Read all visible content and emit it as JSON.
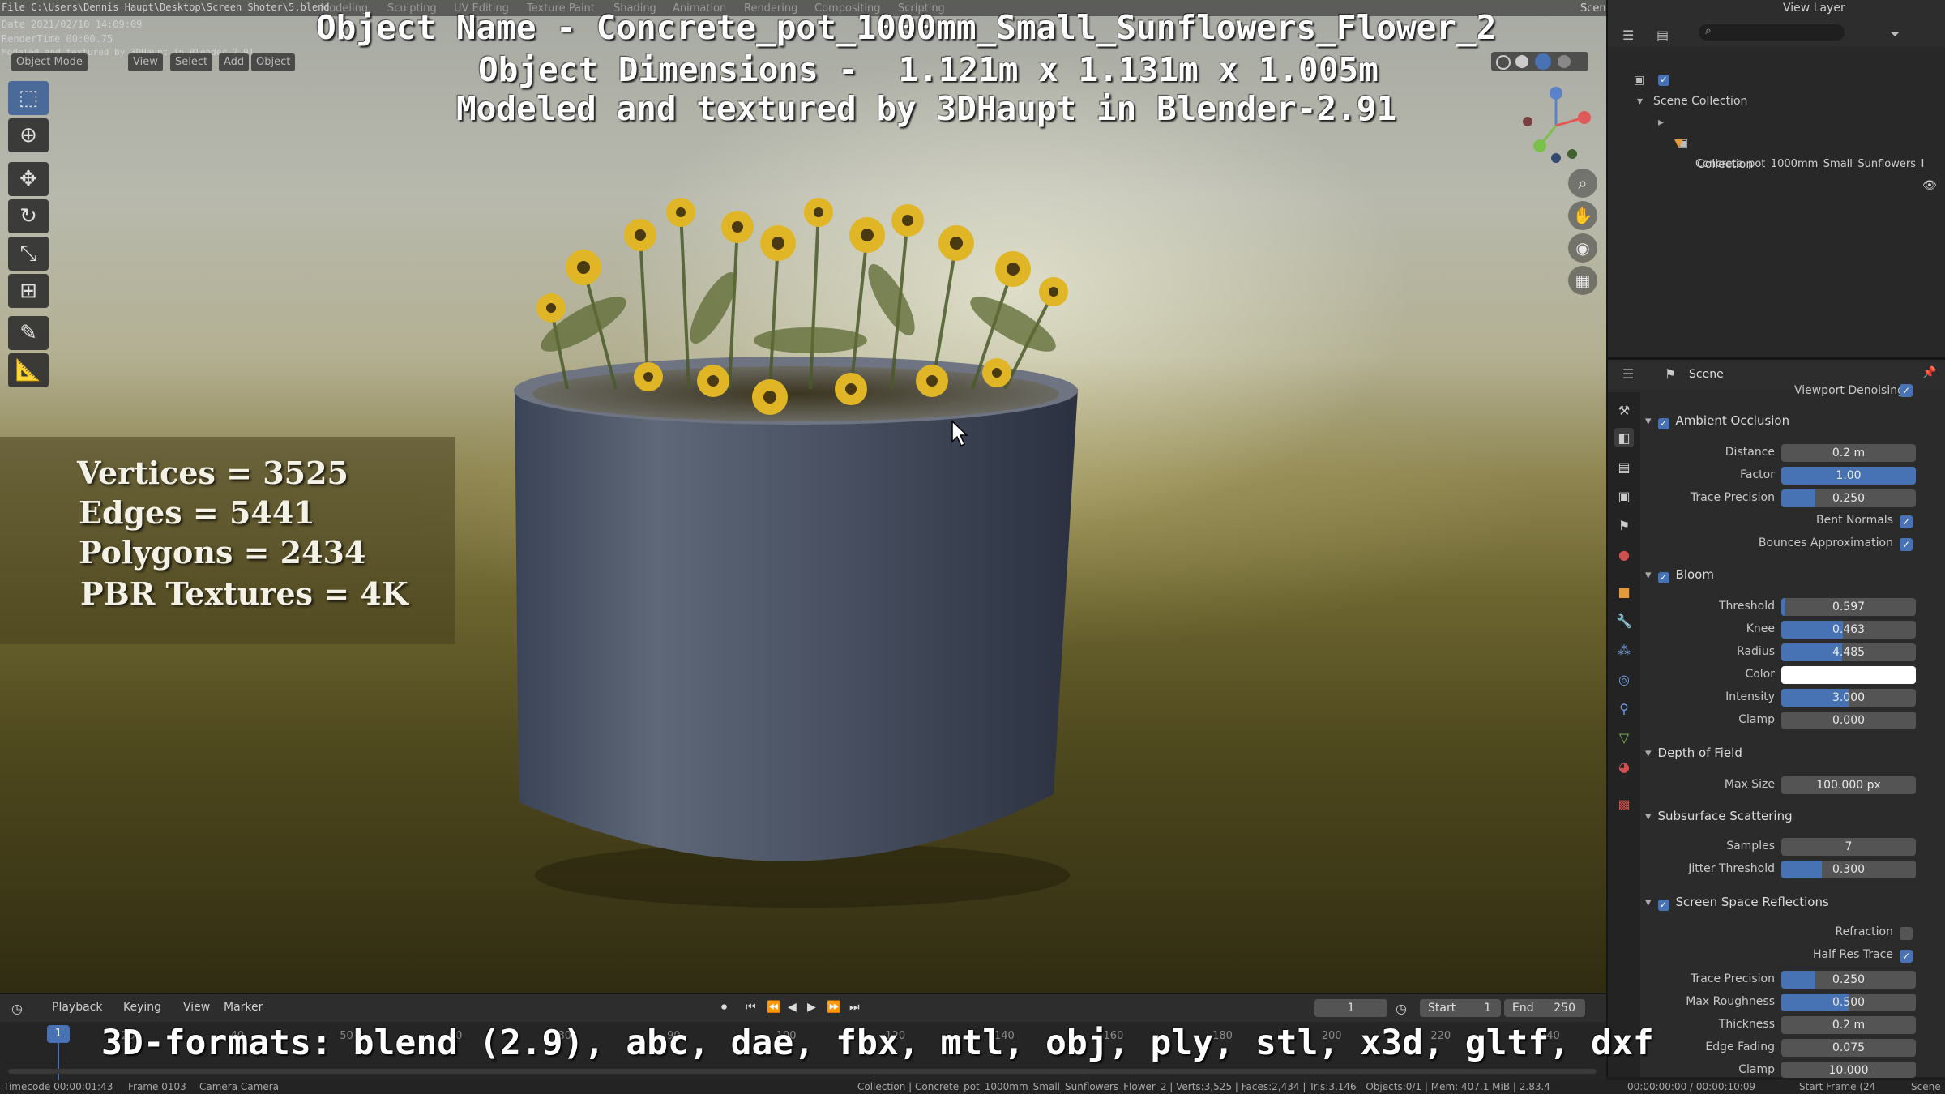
{
  "file_path": "File C:\\Users\\Dennis Haupt\\Desktop\\Screen Shoter\\5.blend",
  "date_line": "Date 2021/02/10 14:09:09",
  "render_time": "RenderTime 00:00.75",
  "modeled_small": "Modeled and textured by 3DHaupt in Blender-2.91",
  "workspace_tabs": [
    "Modeling",
    "Sculpting",
    "UV Editing",
    "Texture Paint",
    "Shading",
    "Animation",
    "Rendering",
    "Compositing",
    "Scripting"
  ],
  "scene_label": "Scene",
  "view_layer_label": "View Layer",
  "header_buttons": [
    "Object Mode",
    "View",
    "Select",
    "Add",
    "Object"
  ],
  "overlay": {
    "title": "Object Name - Concrete_pot_1000mm_Small_Sunflowers_Flower_2",
    "dimensions": "Object Dimensions -  1.121m x 1.131m x 1.005m",
    "modeled": "Modeled and textured by 3DHaupt in Blender-2.91",
    "stats": [
      "Vertices = 3525",
      "Edges = 5441",
      "Polygons = 2434",
      "PBR Textures = 4K"
    ],
    "formats": "3D-formats: blend (2.9), abc, dae, fbx, mtl, obj, ply, stl, x3d, gltf, dxf"
  },
  "tools": [
    "select-icon",
    "cursor-icon",
    "move-icon",
    "rotate-icon",
    "scale-icon",
    "transform-icon",
    "annotate-icon",
    "measure-icon"
  ],
  "outliner": {
    "root": "Scene Collection",
    "collection": "Collection",
    "object": "Concrete_pot_1000mm_Small_Sunflowers_I"
  },
  "properties": {
    "context": "Scene",
    "viewport_denoising": "Viewport Denoising",
    "ao": {
      "title": "Ambient Occlusion",
      "distance_label": "Distance",
      "distance": "0.2 m",
      "factor_label": "Factor",
      "factor": "1.00",
      "factor_fill": 1.0,
      "trace_label": "Trace Precision",
      "trace": "0.250",
      "trace_fill": 0.25,
      "bent_label": "Bent Normals",
      "bounces_label": "Bounces Approximation"
    },
    "bloom": {
      "title": "Bloom",
      "threshold_label": "Threshold",
      "threshold": "0.597",
      "threshold_fill": 0.03,
      "knee_label": "Knee",
      "knee": "0.463",
      "knee_fill": 0.46,
      "radius_label": "Radius",
      "radius": "4.485",
      "radius_fill": 0.45,
      "color_label": "Color",
      "color": "#ffffff",
      "intensity_label": "Intensity",
      "intensity": "3.000",
      "intensity_fill": 0.5,
      "clamp_label": "Clamp",
      "clamp": "0.000"
    },
    "dof": {
      "title": "Depth of Field",
      "maxsize_label": "Max Size",
      "maxsize": "100.000 px"
    },
    "sss": {
      "title": "Subsurface Scattering",
      "samples_label": "Samples",
      "samples": "7",
      "jitter_label": "Jitter Threshold",
      "jitter": "0.300",
      "jitter_fill": 0.3
    },
    "ssr": {
      "title": "Screen Space Reflections",
      "refraction_label": "Refraction",
      "halfres_label": "Half Res Trace",
      "trace_label": "Trace Precision",
      "trace": "0.250",
      "trace_fill": 0.25,
      "roughness_label": "Max Roughness",
      "roughness": "0.500",
      "roughness_fill": 0.5,
      "thickness_label": "Thickness",
      "thickness": "0.2 m",
      "edge_label": "Edge Fading",
      "edge": "0.075",
      "clamp_label": "Clamp",
      "clamp": "10.000"
    }
  },
  "timeline": {
    "playback": "Playback",
    "keying": "Keying",
    "view": "View",
    "marker": "Marker",
    "current_frame": "1",
    "start_label": "Start",
    "start": "1",
    "end_label": "End",
    "end": "250",
    "playhead": "1",
    "ticks": [
      "20",
      "40",
      "50",
      "60",
      "80",
      "90",
      "100",
      "120",
      "140",
      "160",
      "180",
      "200",
      "220",
      "240"
    ]
  },
  "status": {
    "timecode": "Timecode 00:00:01:43",
    "frame": "Frame 0103",
    "camera": "Camera Camera",
    "info": "Collection | Concrete_pot_1000mm_Small_Sunflowers_Flower_2 | Verts:3,525 | Faces:2,434 | Tris:3,146 | Objects:0/1 | Mem: 407.1 MiB | 2.83.4",
    "time_range": "00:00:00:00 / 00:00:10:09",
    "start_frame": "Start Frame (24",
    "scene": "Scene"
  },
  "colors": {
    "accent": "#4772b3",
    "panel": "#2b2b2b"
  }
}
